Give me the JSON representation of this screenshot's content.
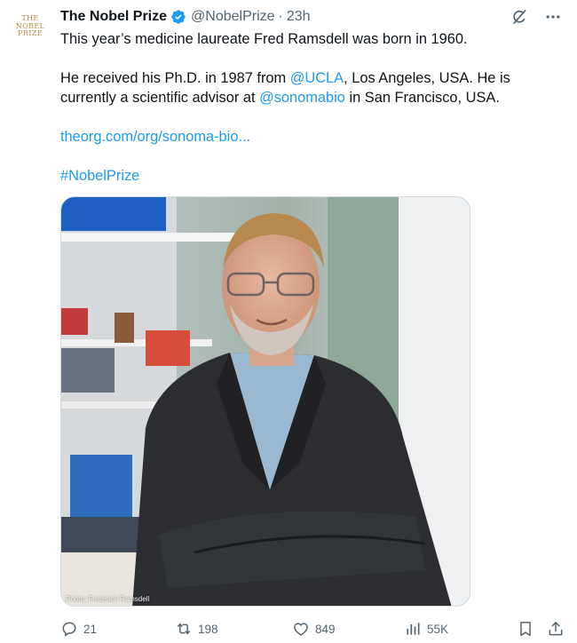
{
  "tweet": {
    "avatar_lines": [
      "THE",
      "NOBEL",
      "PRIZE"
    ],
    "author_name": "The Nobel Prize",
    "handle": "@NobelPrize",
    "separator": "·",
    "time": "23h",
    "body": {
      "line1": "This year’s medicine laureate Fred Ramsdell was born in 1960.",
      "p2_pre": "He received his Ph.D. in 1987 from ",
      "mention1": "@UCLA",
      "p2_mid": ", Los Angeles, USA. He is currently a scientific advisor at ",
      "mention2": "@sonomabio",
      "p2_post": " in San Francisco, USA.",
      "url": "theorg.com/org/sonoma-bio...",
      "hashtag": "#NobelPrize"
    },
    "photo_credit": "Photo: Frederick Ramsdell"
  },
  "actions": {
    "replies": "21",
    "reposts": "198",
    "likes": "849",
    "views": "55K"
  },
  "colors": {
    "link": "#1d9bf0",
    "verified": "#1d9bf0",
    "muted": "#536471",
    "text": "#0f1419",
    "brand_gold": "#b08a3e"
  },
  "icons": [
    "verified-badge-icon",
    "grok-icon",
    "more-icon",
    "reply-icon",
    "repost-icon",
    "like-icon",
    "views-icon",
    "bookmark-icon",
    "share-icon"
  ]
}
